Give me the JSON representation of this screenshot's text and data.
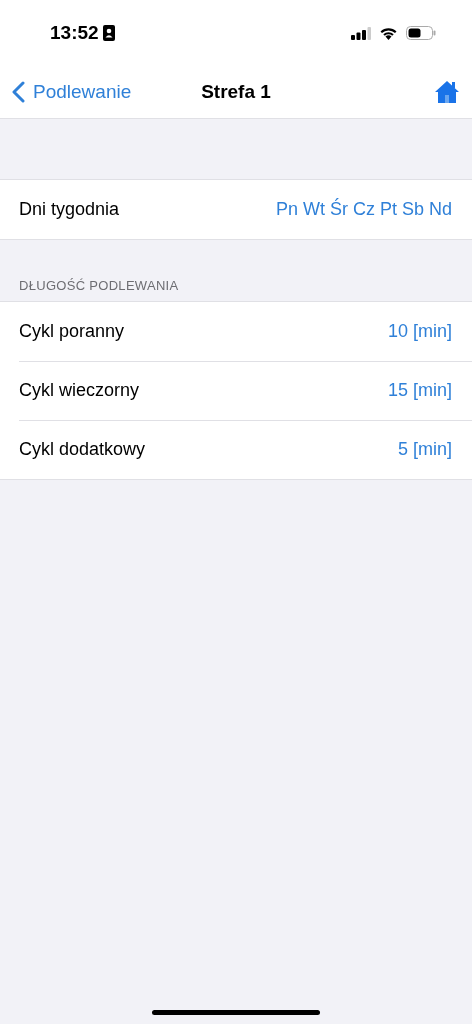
{
  "status_bar": {
    "time": "13:52"
  },
  "nav": {
    "back": "Podlewanie",
    "title": "Strefa 1"
  },
  "days_row": {
    "label": "Dni tygodnia",
    "value": "Pn Wt Śr Cz Pt Sb Nd"
  },
  "section": {
    "header": "DŁUGOŚĆ PODLEWANIA",
    "rows": [
      {
        "label": "Cykl poranny",
        "value": "10 [min]"
      },
      {
        "label": "Cykl wieczorny",
        "value": "15 [min]"
      },
      {
        "label": "Cykl dodatkowy",
        "value": "5 [min]"
      }
    ]
  }
}
